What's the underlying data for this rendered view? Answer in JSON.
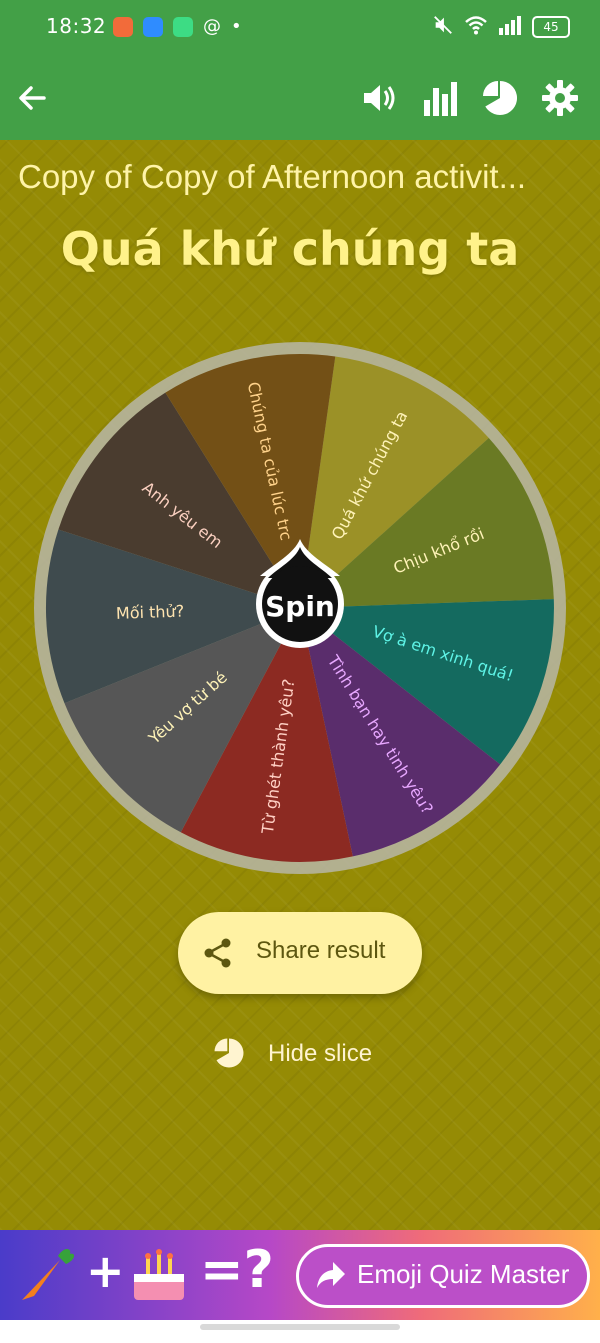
{
  "status_bar": {
    "time": "18:32",
    "battery": "45"
  },
  "toolbar": {
    "icons": [
      "back-arrow-icon",
      "volume-icon",
      "bar-chart-icon",
      "pie-chart-icon",
      "settings-gear-icon"
    ]
  },
  "list_title": "Copy of Copy of Afternoon activit...",
  "wheel_title": "Quá khứ chúng ta",
  "wheel": {
    "spin_label": "Spin",
    "slices": [
      {
        "label": "Quá khứ chúng ta",
        "color": "#9b9127"
      },
      {
        "label": "Chịu khổ rồi",
        "color": "#6a7a24"
      },
      {
        "label": "Vợ à em xinh quá!",
        "color": "#146a5f"
      },
      {
        "label": "Tình bạn hay tình yêu?",
        "color": "#5a2d6c"
      },
      {
        "label": "Từ ghét thành yêu?",
        "color": "#8c2a22"
      },
      {
        "label": "Yêu vợ từ bé",
        "color": "#565656"
      },
      {
        "label": "Mối thử?",
        "color": "#3f4b4e"
      },
      {
        "label": "Anh yêu em",
        "color": "#4a3c2f"
      },
      {
        "label": "Chúng ta của lúc trc",
        "color": "#735016"
      }
    ],
    "label_colors": [
      "#fff3b8",
      "#fff3b8",
      "#5ef3e6",
      "#e7a7ff",
      "#ffd0c4",
      "#fff3b8",
      "#ffe4b0",
      "#fbd0c0",
      "#ffd28a"
    ]
  },
  "actions": {
    "share_label": "Share result",
    "hide_slice_label": "Hide slice"
  },
  "ad": {
    "cta_label": "Emoji Quiz Master",
    "plus": "+",
    "equals": "=?"
  }
}
